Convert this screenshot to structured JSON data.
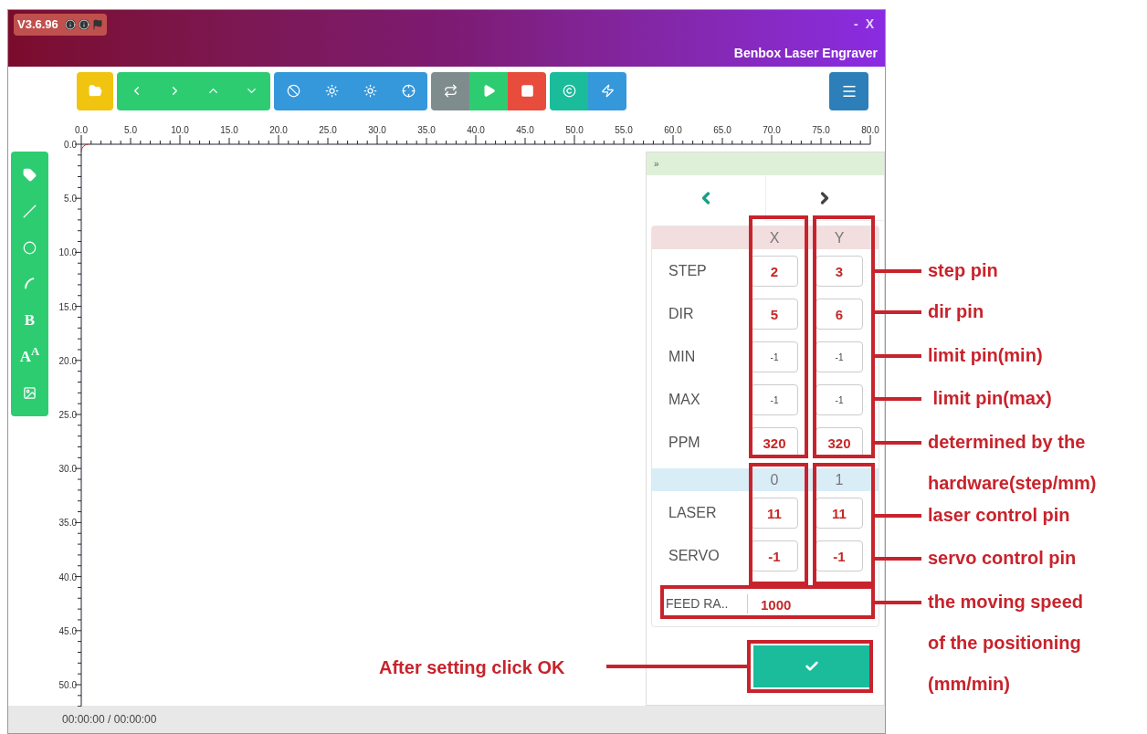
{
  "window": {
    "version": "V3.6.96",
    "title": "Benbox Laser Engraver",
    "controls": [
      "-",
      "X"
    ]
  },
  "drawing_tools": [
    {
      "kind": "tag"
    },
    {
      "kind": "line"
    },
    {
      "kind": "circle"
    },
    {
      "kind": "arc"
    },
    {
      "kind": "glyph",
      "glyph": "B"
    },
    {
      "kind": "glyph",
      "glyph": "A$^{A}$"
    },
    {
      "kind": "image"
    }
  ],
  "ruler": {
    "x_labels": [
      "0.0",
      "5.0",
      "10.0",
      "15.0",
      "20.0",
      "25.0",
      "30.0",
      "35.0",
      "40.0",
      "45.0",
      "50.0",
      "55.0",
      "60.0",
      "65.0",
      "70.0",
      "75.0",
      "80.0"
    ],
    "y_labels": [
      "0.0",
      "5.0",
      "10.0",
      "15.0",
      "20.0",
      "25.0",
      "30.0",
      "35.0",
      "40.0",
      "45.0",
      "50.0"
    ]
  },
  "panel": {
    "collapse": "»",
    "axis_headers": [
      "X",
      "Y"
    ],
    "axis_rows": [
      {
        "label": "STEP",
        "cells": [
          {
            "value": "2",
            "emphasized": true
          },
          {
            "value": "3",
            "emphasized": true
          }
        ]
      },
      {
        "label": "DIR",
        "cells": [
          {
            "value": "5",
            "emphasized": true
          },
          {
            "value": "6",
            "emphasized": true
          }
        ]
      },
      {
        "label": "MIN",
        "cells": [
          {
            "value": "-1",
            "emphasized": false
          },
          {
            "value": "-1",
            "emphasized": false
          }
        ]
      },
      {
        "label": "MAX",
        "cells": [
          {
            "value": "-1",
            "emphasized": false
          },
          {
            "value": "-1",
            "emphasized": false
          }
        ]
      },
      {
        "label": "PPM",
        "cells": [
          {
            "value": "320",
            "emphasized": true
          },
          {
            "value": "320",
            "emphasized": true
          }
        ]
      }
    ],
    "output_headers": [
      "0",
      "1"
    ],
    "output_rows": [
      {
        "label": "LASER",
        "cells": [
          {
            "value": "11",
            "emphasized": true
          },
          {
            "value": "11",
            "emphasized": true
          }
        ]
      },
      {
        "label": "SERVO",
        "cells": [
          {
            "value": "-1",
            "emphasized": true
          },
          {
            "value": "-1",
            "emphasized": true
          }
        ]
      }
    ],
    "feed": {
      "label": "FEED RA..",
      "value": "1000"
    }
  },
  "status_bar": "00:00:00 / 00:00:00",
  "annotations": [
    {
      "lines": [
        "step pin"
      ]
    },
    {
      "lines": [
        "dir pin"
      ]
    },
    {
      "lines": [
        "limit pin(min)"
      ]
    },
    {
      "lines": [
        " limit pin(max)"
      ]
    },
    {
      "lines": [
        "determined by the",
        "hardware(step/mm)"
      ]
    },
    {
      "lines": [
        "laser control pin"
      ]
    },
    {
      "lines": [
        "servo control pin"
      ]
    },
    {
      "lines": [
        "the moving speed",
        "of the positioning",
        "(mm/min)"
      ]
    }
  ],
  "ok_annotation": "After setting click OK"
}
